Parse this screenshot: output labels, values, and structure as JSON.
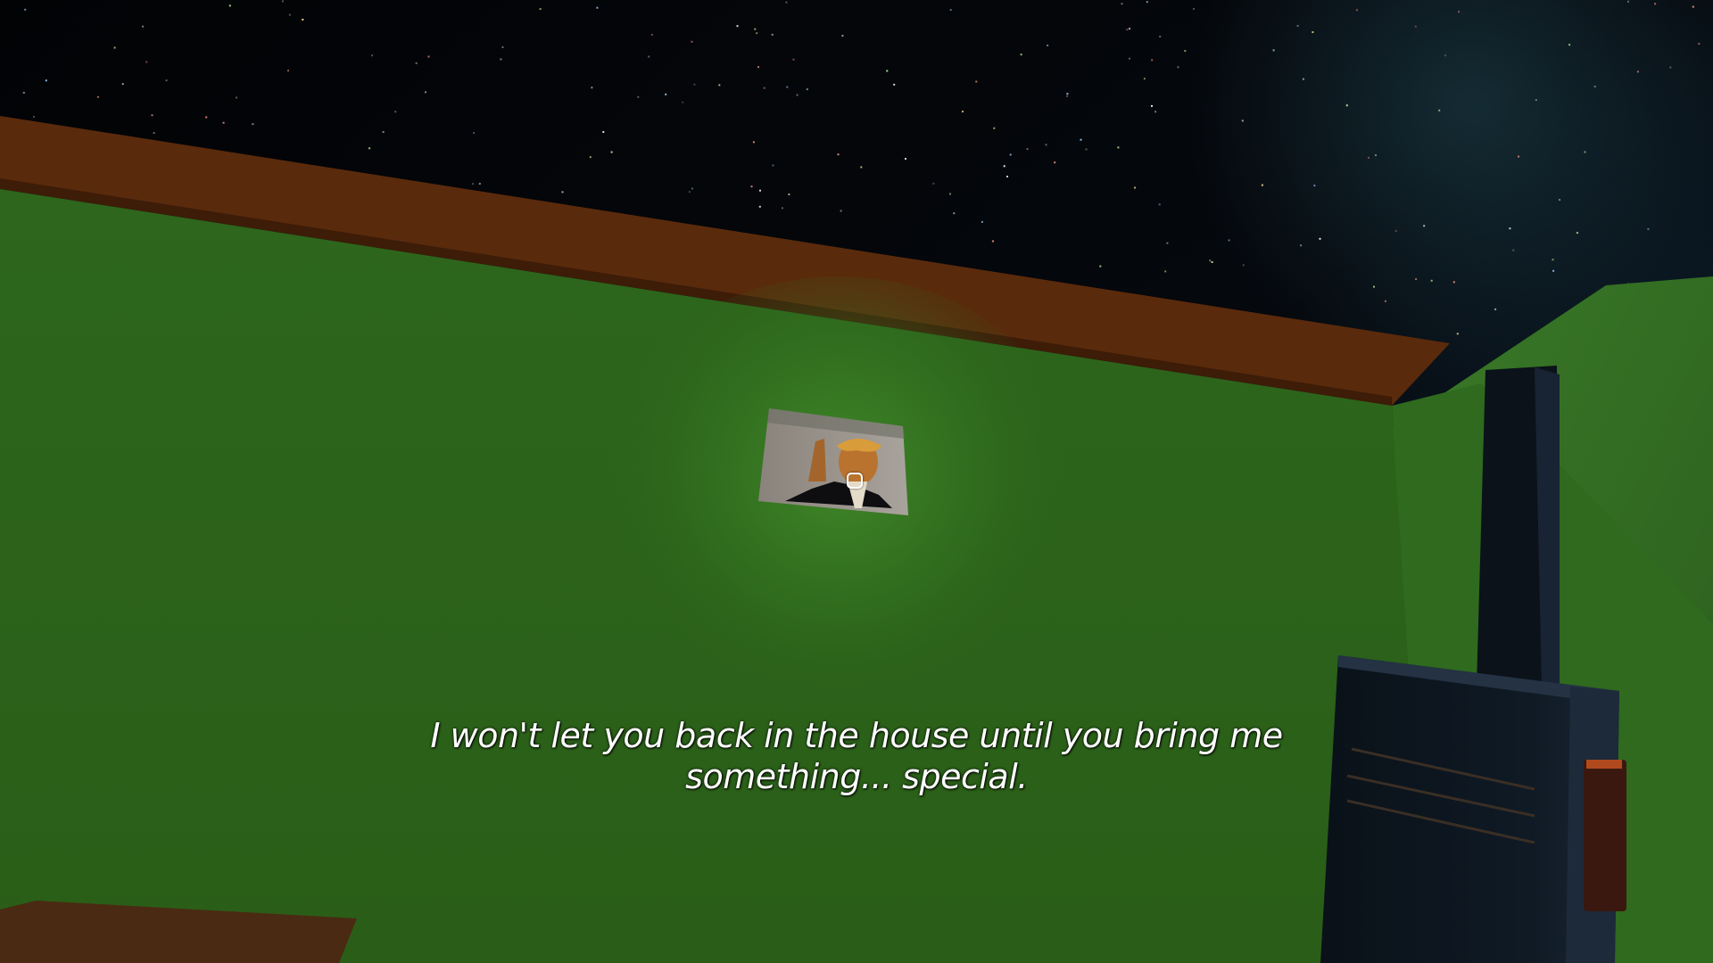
{
  "hud": {
    "subtitle_line1": "I won't let you back in the house until you bring me",
    "subtitle_line2": "something... special."
  },
  "scene": {
    "sky_color": "#05070b",
    "ground_color": "#2f6a1e",
    "wall_top_color": "#5a2a0c",
    "radio_color": "#0d1620",
    "flashlight_glow_color": "#3f8a2a"
  },
  "icons": {
    "crosshair": "rounded-square-reticle",
    "held_item": "walkie-talkie"
  }
}
